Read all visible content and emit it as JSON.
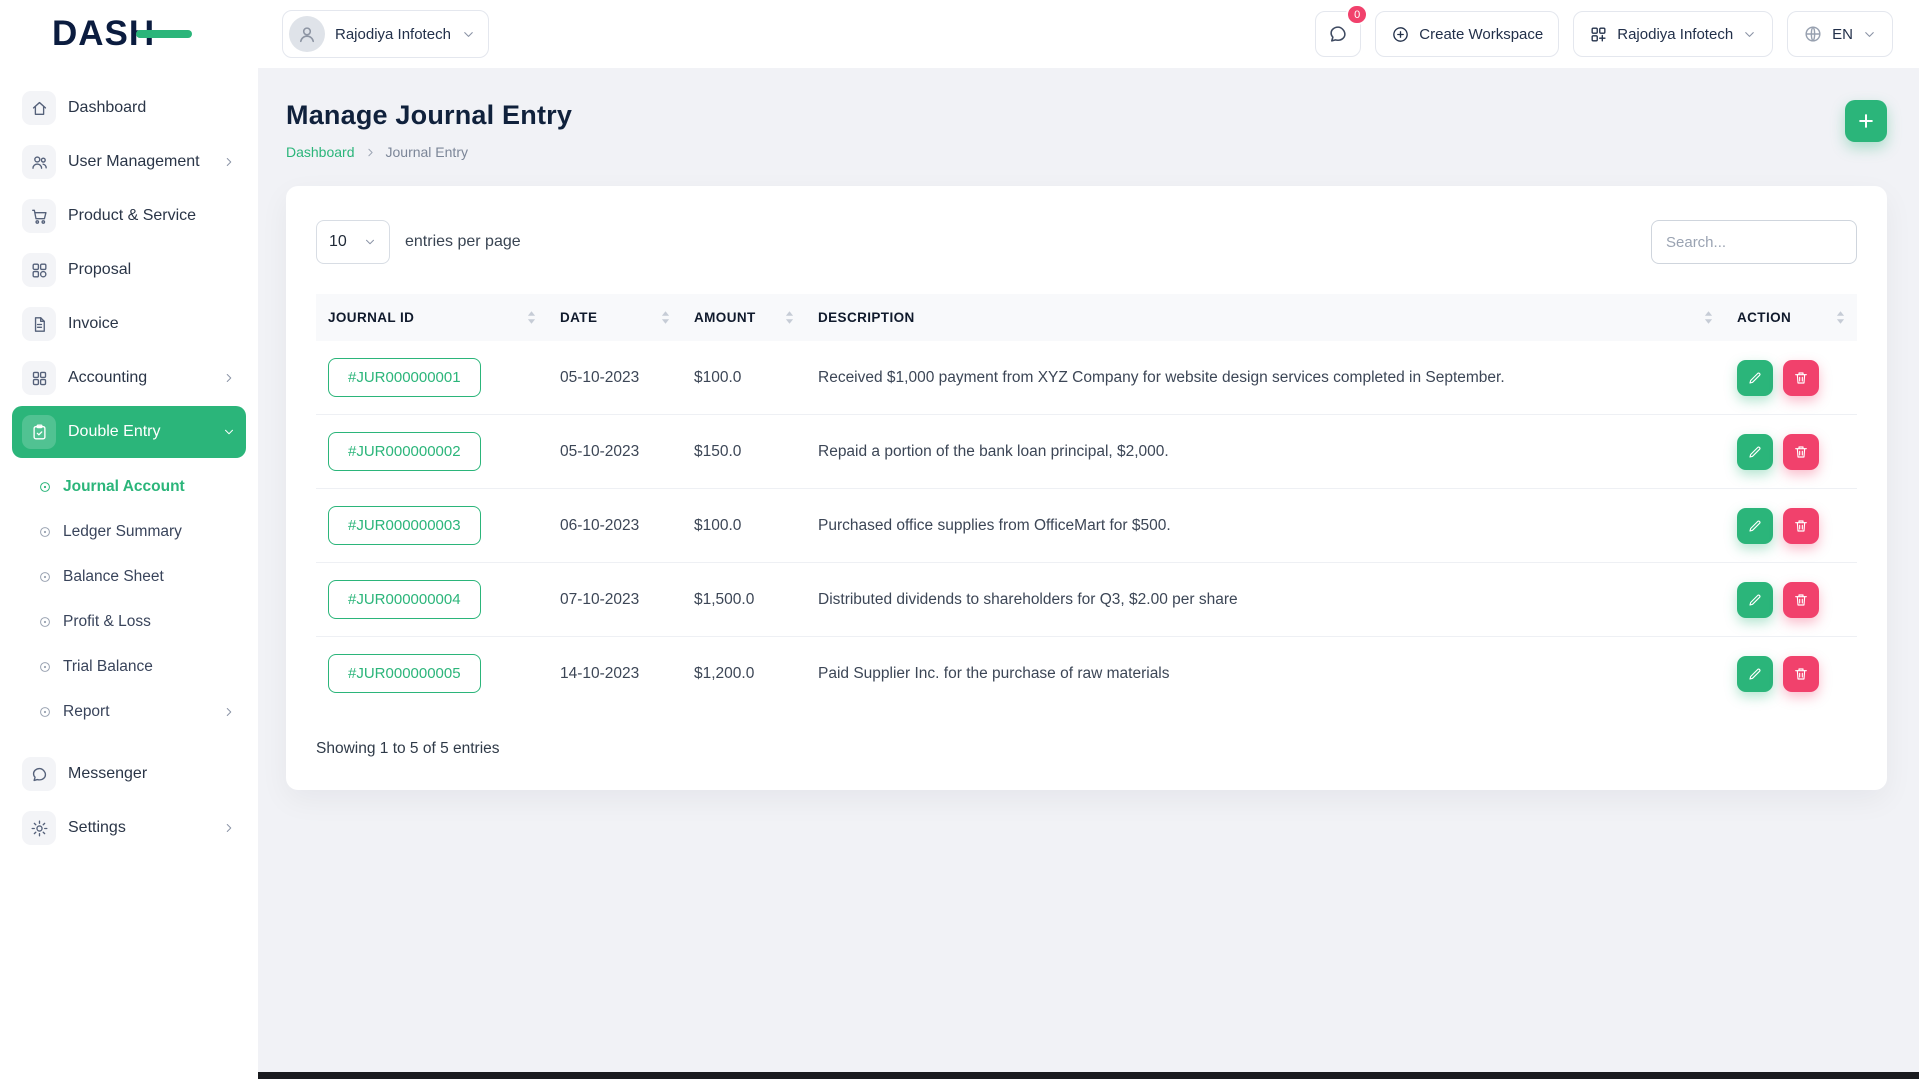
{
  "header": {
    "logo_text": "DASH",
    "workspace_name": "Rajodiya Infotech",
    "messages_badge": "0",
    "create_workspace_label": "Create Workspace",
    "company_name": "Rajodiya Infotech",
    "language": "EN"
  },
  "sidebar": {
    "items": [
      {
        "label": "Dashboard"
      },
      {
        "label": "User Management"
      },
      {
        "label": "Product & Service"
      },
      {
        "label": "Proposal"
      },
      {
        "label": "Invoice"
      },
      {
        "label": "Accounting"
      },
      {
        "label": "Double Entry"
      }
    ],
    "double_entry_sub": [
      {
        "label": "Journal Account"
      },
      {
        "label": "Ledger Summary"
      },
      {
        "label": "Balance Sheet"
      },
      {
        "label": "Profit & Loss"
      },
      {
        "label": "Trial Balance"
      },
      {
        "label": "Report"
      }
    ],
    "footer_items": [
      {
        "label": "Messenger"
      },
      {
        "label": "Settings"
      }
    ]
  },
  "page": {
    "title": "Manage Journal Entry",
    "breadcrumb_home": "Dashboard",
    "breadcrumb_current": "Journal Entry"
  },
  "toolbar": {
    "entries_value": "10",
    "entries_label": "entries per page",
    "search_placeholder": "Search..."
  },
  "table": {
    "headers": {
      "journal_id": "JOURNAL ID",
      "date": "DATE",
      "amount": "AMOUNT",
      "description": "DESCRIPTION",
      "action": "ACTION"
    },
    "rows": [
      {
        "id": "#JUR000000001",
        "date": "05-10-2023",
        "amount": "$100.0",
        "description": "Received $1,000 payment from XYZ Company for website design services completed in September."
      },
      {
        "id": "#JUR000000002",
        "date": "05-10-2023",
        "amount": "$150.0",
        "description": "Repaid a portion of the bank loan principal, $2,000."
      },
      {
        "id": "#JUR000000003",
        "date": "06-10-2023",
        "amount": "$100.0",
        "description": "Purchased office supplies from OfficeMart for $500."
      },
      {
        "id": "#JUR000000004",
        "date": "07-10-2023",
        "amount": "$1,500.0",
        "description": "Distributed dividends to shareholders for Q3, $2.00 per share"
      },
      {
        "id": "#JUR000000005",
        "date": "14-10-2023",
        "amount": "$1,200.0",
        "description": "Paid Supplier Inc. for the purchase of raw materials"
      }
    ],
    "summary": "Showing 1 to 5 of 5 entries"
  },
  "colors": {
    "primary": "#2bb57a",
    "danger": "#f1416c"
  }
}
